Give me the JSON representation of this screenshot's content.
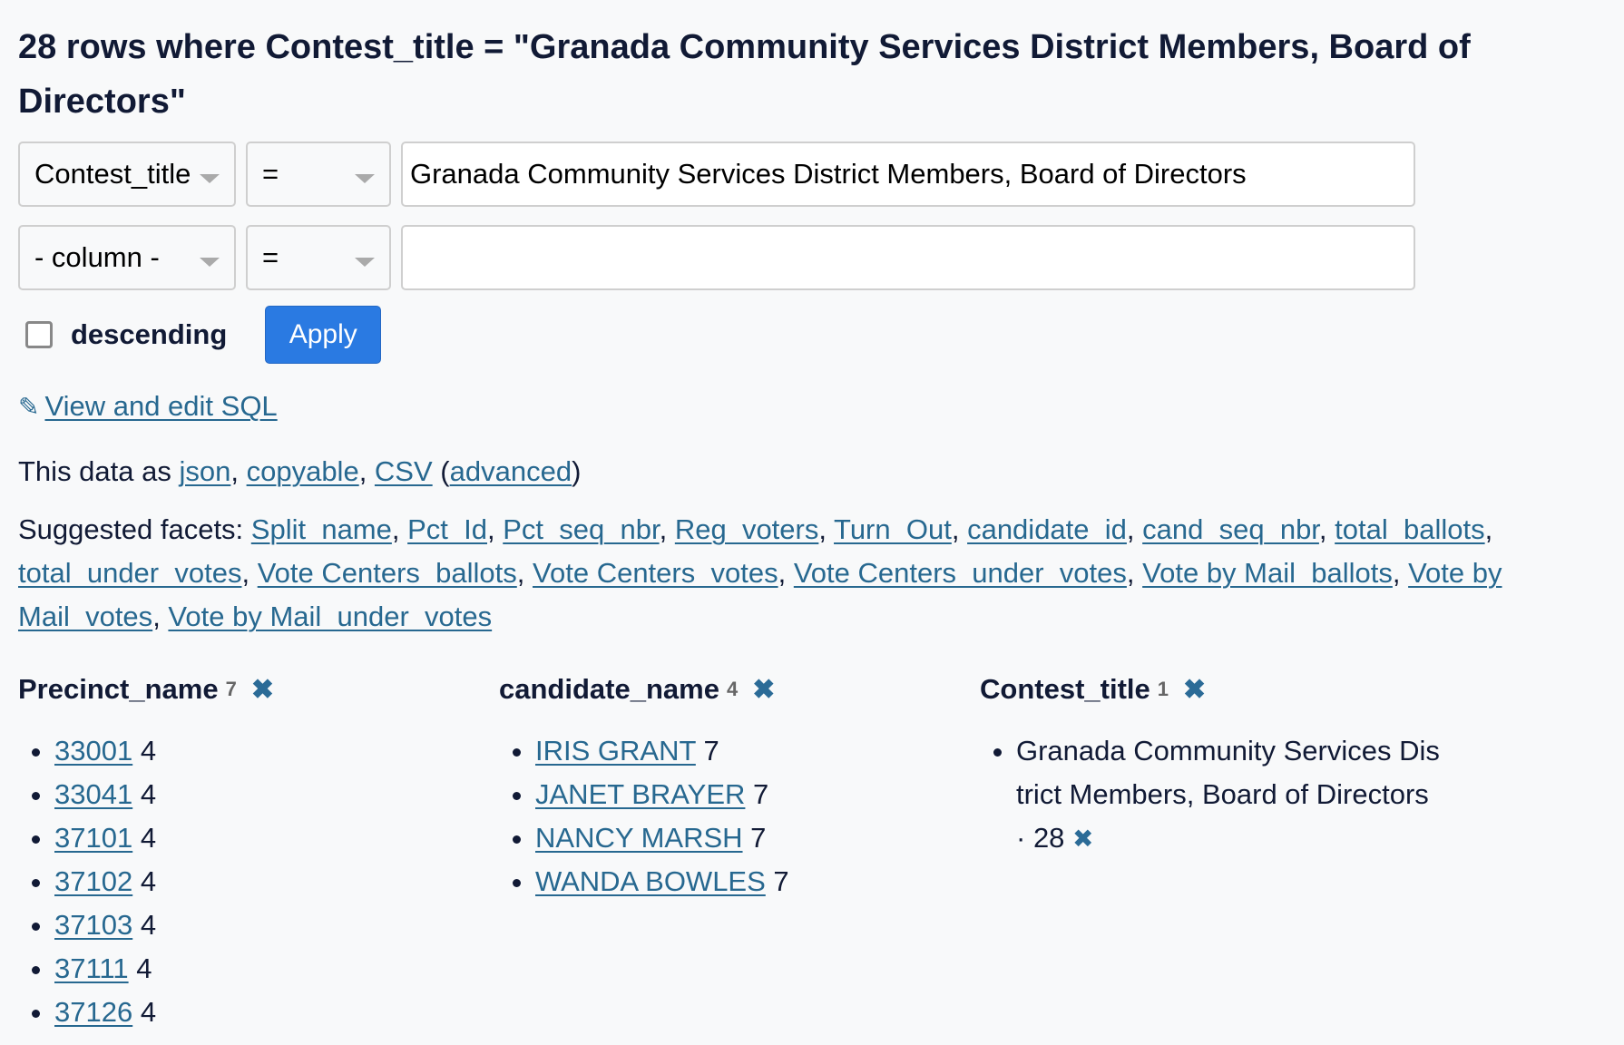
{
  "page_title": "28 rows where Contest_title = \"Granada Community Services District Members, Board of Directors\"",
  "filters": [
    {
      "column": "Contest_title",
      "operator": "=",
      "value": "Granada Community Services District Members, Board of Directors"
    },
    {
      "column": "- column -",
      "operator": "=",
      "value": ""
    }
  ],
  "sort": {
    "descending_label": "descending",
    "descending_checked": false,
    "apply_label": "Apply"
  },
  "sql_link": {
    "icon": "pencil-icon",
    "label": "View and edit SQL"
  },
  "export": {
    "prefix": "This data as ",
    "json": "json",
    "copyable": "copyable",
    "csv": "CSV",
    "advanced": "advanced"
  },
  "suggested_facets": {
    "label": "Suggested facets: ",
    "items": [
      "Split_name",
      "Pct_Id",
      "Pct_seq_nbr",
      "Reg_voters",
      "Turn_Out",
      "candidate_id",
      "cand_seq_nbr",
      "total_ballots",
      "total_under_votes",
      "Vote Centers_ballots",
      "Vote Centers_votes",
      "Vote Centers_under_votes",
      "Vote by Mail_ballots",
      "Vote by Mail_votes",
      "Vote by Mail_under_votes"
    ]
  },
  "facets": [
    {
      "name": "Precinct_name",
      "count": "7",
      "items": [
        {
          "value": "33001",
          "count": "4"
        },
        {
          "value": "33041",
          "count": "4"
        },
        {
          "value": "37101",
          "count": "4"
        },
        {
          "value": "37102",
          "count": "4"
        },
        {
          "value": "37103",
          "count": "4"
        },
        {
          "value": "37111",
          "count": "4"
        },
        {
          "value": "37126",
          "count": "4"
        }
      ]
    },
    {
      "name": "candidate_name",
      "count": "4",
      "items": [
        {
          "value": "IRIS GRANT",
          "count": "7"
        },
        {
          "value": "JANET BRAYER",
          "count": "7"
        },
        {
          "value": "NANCY MARSH",
          "count": "7"
        },
        {
          "value": "WANDA BOWLES",
          "count": "7"
        }
      ]
    },
    {
      "name": "Contest_title",
      "count": "1",
      "selected_item": {
        "value": "Granada Community Services District Members, Board of Directors",
        "count": "28"
      }
    }
  ],
  "colors": {
    "link": "#276890",
    "apply_button": "#2a7ae2",
    "text": "#111a35",
    "remove_icon": "#2b6b97"
  }
}
